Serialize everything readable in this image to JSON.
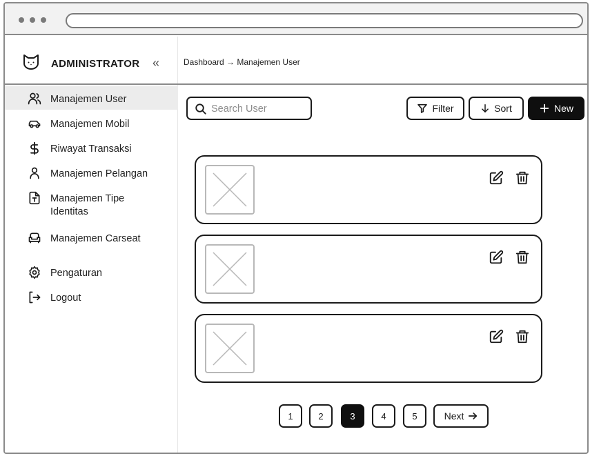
{
  "sidebar": {
    "brand_title": "ADMINISTRATOR",
    "collapse_glyph": "«",
    "items": [
      {
        "label": "Manajemen User",
        "icon": "users-icon",
        "active": true
      },
      {
        "label": "Manajemen Mobil",
        "icon": "car-icon"
      },
      {
        "label": "Riwayat Transaksi",
        "icon": "dollar-icon"
      },
      {
        "label": "Manajemen Pelangan",
        "icon": "user-icon"
      },
      {
        "label": "Manajemen Tipe",
        "label2": "Identitas",
        "icon": "file-text-icon"
      },
      {
        "label": "Manajemen Carseat",
        "icon": "armchair-icon"
      },
      {
        "label": "Pengaturan",
        "icon": "gear-icon"
      },
      {
        "label": "Logout",
        "icon": "logout-icon"
      }
    ]
  },
  "header": {
    "breadcrumb": "Dashboard → Manajemen User"
  },
  "toolbar": {
    "search_placeholder": "Search User",
    "filter_label": "Filter",
    "sort_label": "Sort",
    "new_label": "New"
  },
  "pagination": {
    "pages": [
      "1",
      "2",
      "3",
      "4",
      "5"
    ],
    "current": "3",
    "next_label": "Next"
  },
  "colors": {
    "accent": "#0f0f0f",
    "border": "#1a1a1a",
    "active_bg": "#ececec",
    "placeholder": "#b8b8b8"
  }
}
